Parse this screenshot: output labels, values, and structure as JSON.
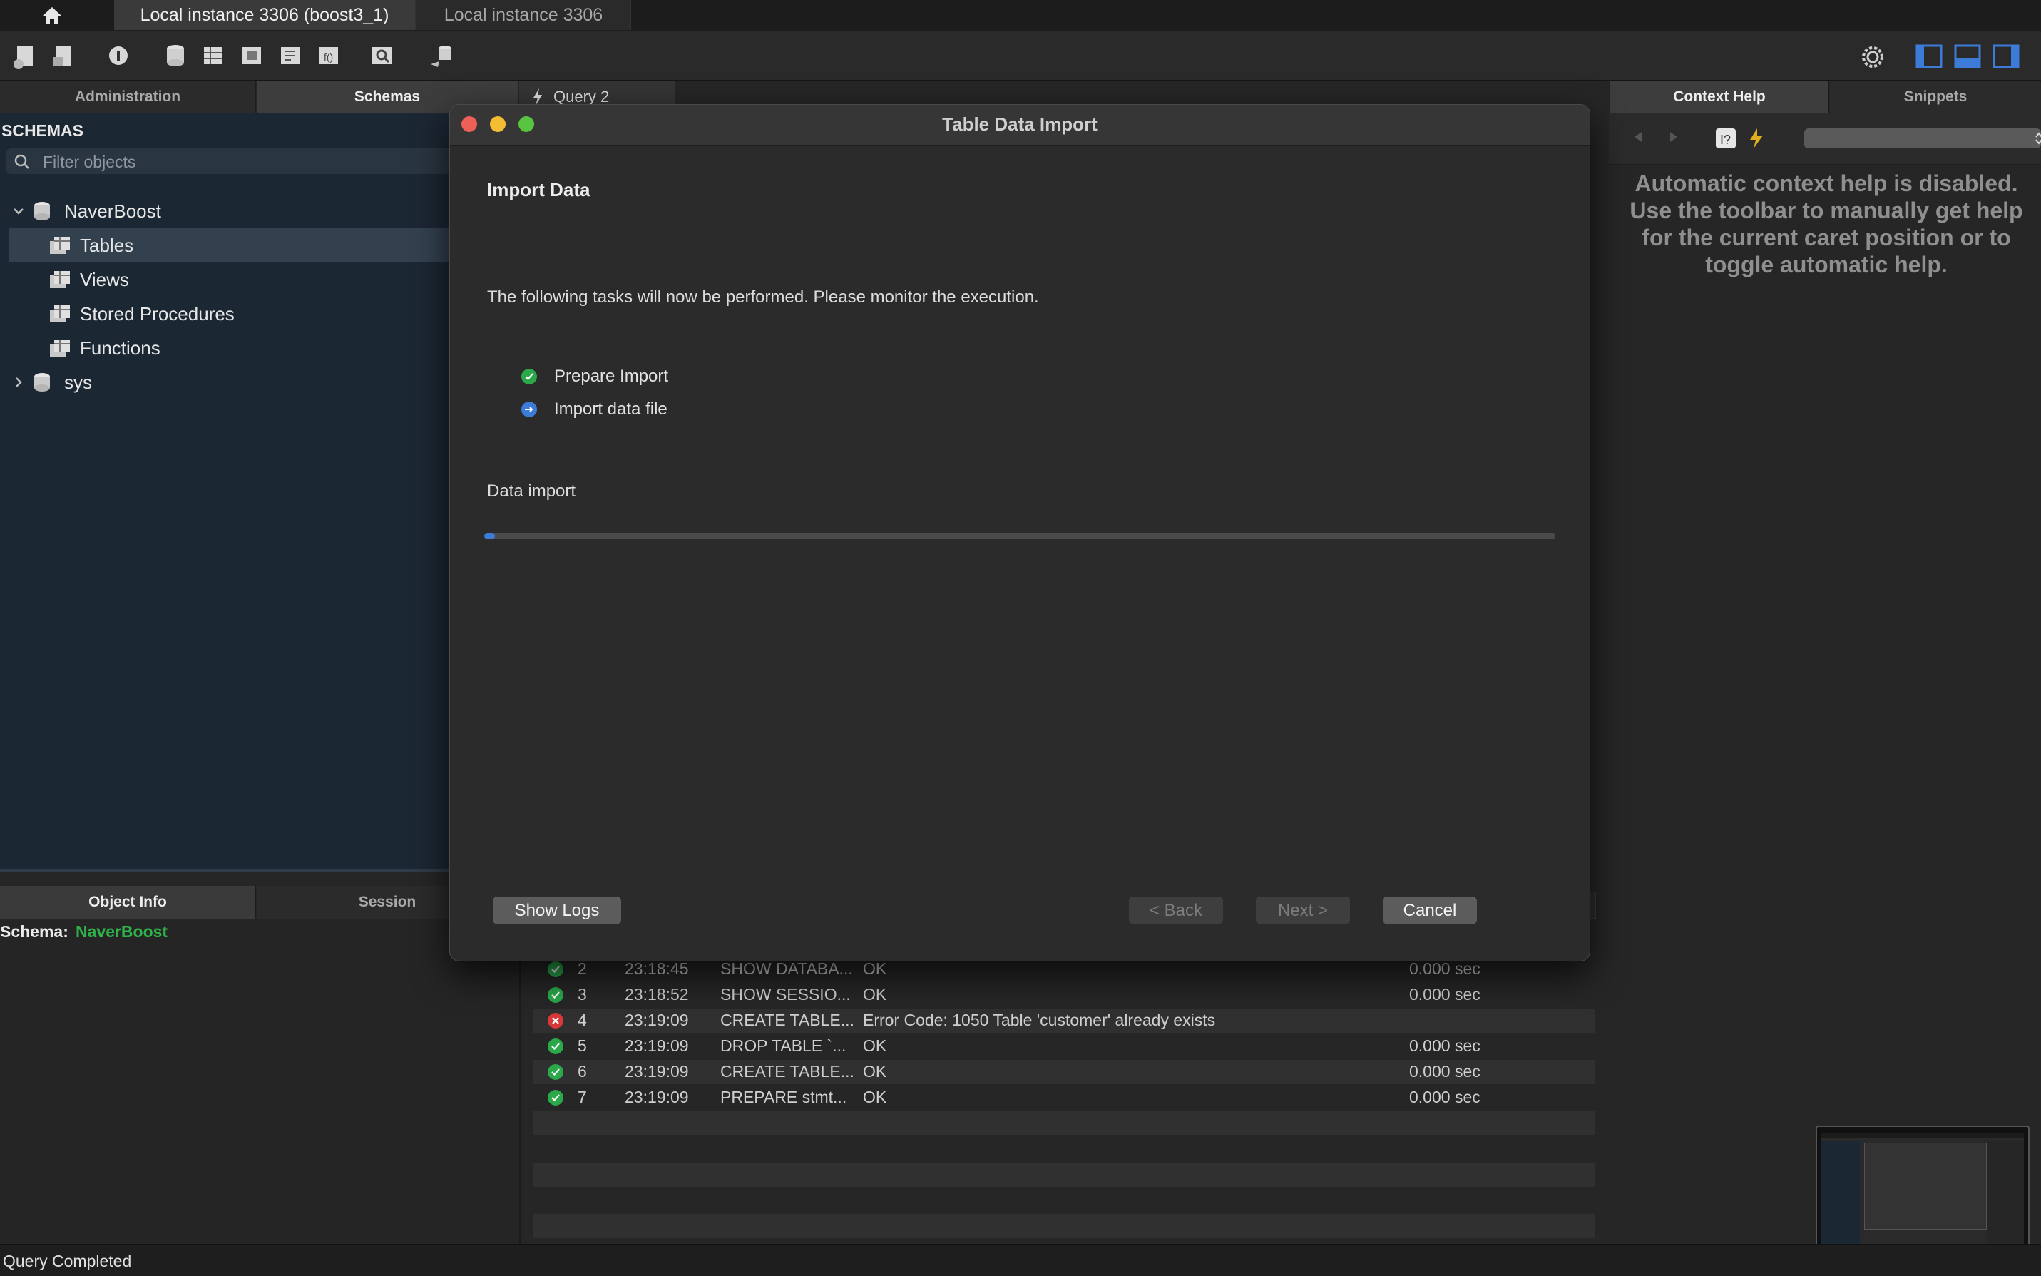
{
  "tabs": {
    "home_icon": "home-icon",
    "items": [
      {
        "label": "Local instance 3306 (boost3_1)",
        "active": true
      },
      {
        "label": "Local instance 3306",
        "active": false
      }
    ]
  },
  "panel_tabs": {
    "left": [
      "Administration",
      "Schemas"
    ],
    "query": "Query 2",
    "right": [
      "Context Help",
      "Snippets"
    ],
    "bottom_left": [
      "Object Info",
      "Session"
    ]
  },
  "sidebar": {
    "heading": "SCHEMAS",
    "filter_placeholder": "Filter objects",
    "tree": [
      {
        "label": "NaverBoost",
        "type": "schema",
        "expanded": true
      },
      {
        "label": "Tables",
        "type": "folder",
        "selected": true
      },
      {
        "label": "Views",
        "type": "folder"
      },
      {
        "label": "Stored Procedures",
        "type": "folder"
      },
      {
        "label": "Functions",
        "type": "folder"
      },
      {
        "label": "sys",
        "type": "schema",
        "expanded": false
      }
    ]
  },
  "object_info": {
    "label": "Schema:",
    "value": "NaverBoost"
  },
  "context_help": {
    "message": "Automatic context help is disabled. Use the toolbar to manually get help for the current caret position or to toggle automatic help."
  },
  "dialog": {
    "title": "Table Data Import",
    "heading": "Import Data",
    "description": "The following tasks will now be performed. Please monitor the execution.",
    "tasks": [
      {
        "label": "Prepare Import",
        "state": "done"
      },
      {
        "label": "Import data file",
        "state": "running"
      }
    ],
    "progress_label": "Data import",
    "progress_value": 0.01,
    "buttons": {
      "show_logs": "Show Logs",
      "back": "< Back",
      "next": "Next >",
      "cancel": "Cancel"
    }
  },
  "output_log": {
    "rows": [
      {
        "num": "2",
        "time": "23:18:45",
        "action": "SHOW DATABA...",
        "message": "OK",
        "duration": "0.000 sec",
        "status": "ok"
      },
      {
        "num": "3",
        "time": "23:18:52",
        "action": "SHOW SESSIO...",
        "message": "OK",
        "duration": "0.000 sec",
        "status": "ok"
      },
      {
        "num": "4",
        "time": "23:19:09",
        "action": "CREATE TABLE...",
        "message": "Error Code: 1050 Table 'customer' already exists",
        "duration": "",
        "status": "error"
      },
      {
        "num": "5",
        "time": "23:19:09",
        "action": "DROP TABLE `...",
        "message": "OK",
        "duration": "0.000 sec",
        "status": "ok"
      },
      {
        "num": "6",
        "time": "23:19:09",
        "action": "CREATE TABLE...",
        "message": "OK",
        "duration": "0.000 sec",
        "status": "ok"
      },
      {
        "num": "7",
        "time": "23:19:09",
        "action": "PREPARE stmt...",
        "message": "OK",
        "duration": "0.000 sec",
        "status": "ok"
      }
    ]
  },
  "statusbar": {
    "text": "Query Completed"
  },
  "colors": {
    "accent_blue": "#3d7bd9",
    "ok_green": "#2aa84a",
    "error_red": "#d93838",
    "schema_green": "#2fb24a",
    "sidebar_bg": "#1c2734"
  }
}
